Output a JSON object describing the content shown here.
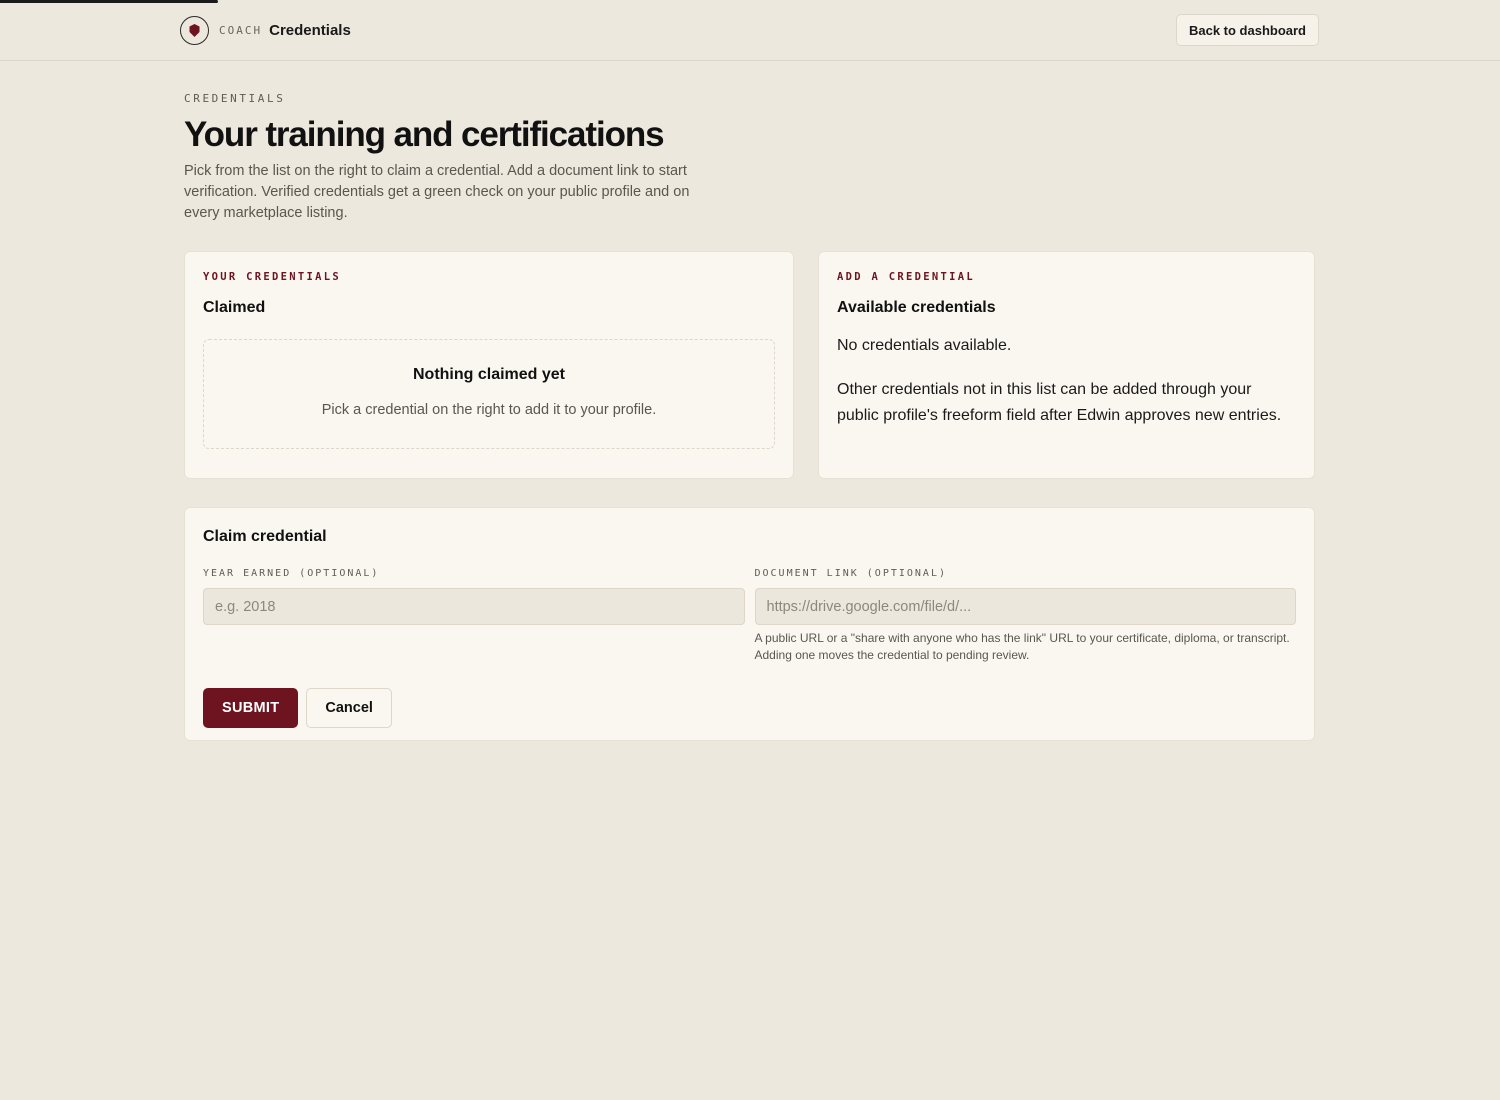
{
  "app": {
    "brand_sub": "COACH",
    "brand_title": "Credentials",
    "back_label": "Back to dashboard"
  },
  "header": {
    "eyebrow": "CREDENTIALS",
    "title": "Your training and certifications",
    "intro": "Pick from the list on the right to claim a credential. Add a document link to start verification. Verified credentials get a green check on your public profile and on every marketplace listing."
  },
  "claimed": {
    "eyebrow": "YOUR CREDENTIALS",
    "title": "Claimed",
    "empty_title": "Nothing claimed yet",
    "empty_text": "Pick a credential on the right to add it to your profile."
  },
  "available": {
    "eyebrow": "ADD A CREDENTIAL",
    "title": "Available credentials",
    "none_text": "No credentials available.",
    "note": "Other credentials not in this list can be added through your public profile's freeform field after Edwin approves new entries."
  },
  "claim_form": {
    "title": "Claim credential",
    "year_label": "YEAR EARNED (OPTIONAL)",
    "year_placeholder": "e.g. 2018",
    "doc_label": "DOCUMENT LINK (OPTIONAL)",
    "doc_placeholder": "https://drive.google.com/file/d/...",
    "doc_help": "A public URL or a \"share with anyone who has the link\" URL to your certificate, diploma, or transcript. Adding one moves the credential to pending review.",
    "submit_label": "SUBMIT",
    "cancel_label": "Cancel"
  },
  "colors": {
    "accent": "#6e1420",
    "background": "#ede8dd",
    "card": "#faf7f1"
  }
}
